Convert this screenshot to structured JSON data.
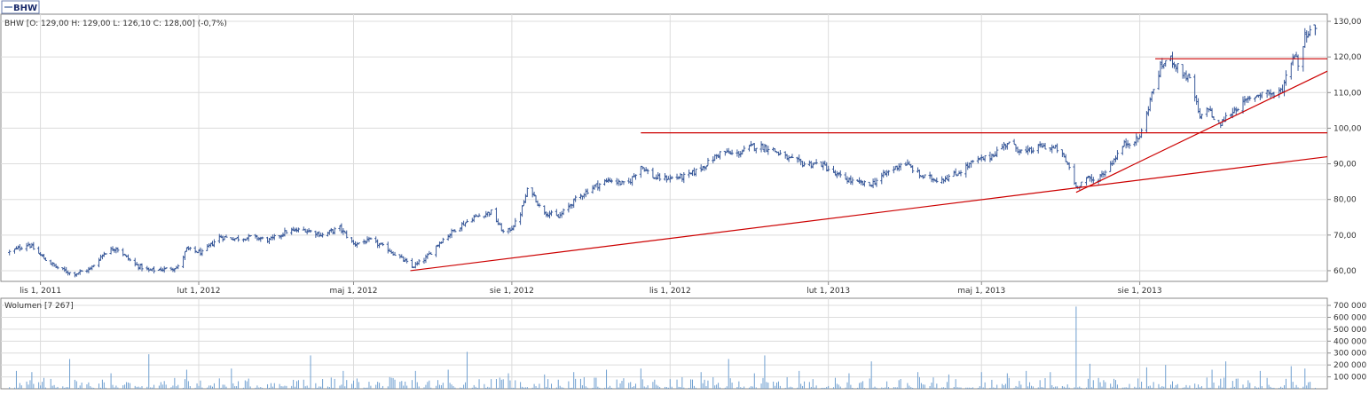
{
  "tab": {
    "label": "BHW"
  },
  "colors": {
    "price": "#3a5a9a",
    "trend": "#cc0000",
    "volume": "#6f9fd0",
    "grid": "#dcdcdc",
    "frame": "#8a8a8a",
    "text": "#333333"
  },
  "chart_data": [
    {
      "type": "line",
      "style": "ohlc",
      "legend": "BHW [O: 129,00  H: 129,00  L: 126,10  C: 128,00] (-0,7%)",
      "ohlc": {
        "open": 129.0,
        "high": 129.0,
        "low": 126.1,
        "close": 128.0,
        "change_pct": -0.7
      },
      "x_ticks": [
        "lis 1, 2011",
        "lut 1, 2012",
        "maj 1, 2012",
        "sie 1, 2012",
        "lis 1, 2012",
        "lut 1, 2013",
        "maj 1, 2013",
        "sie 1, 2013"
      ],
      "y_ticks": [
        "60,00",
        "70,00",
        "80,00",
        "90,00",
        "100,00",
        "110,00",
        "120,00",
        "130,00"
      ],
      "ylim": [
        57,
        132
      ],
      "xlim": [
        "2011-10-09",
        "2013-11-18"
      ],
      "grid": true,
      "series": [
        {
          "values": [
            [
              "2011-10-14",
              65.2
            ],
            [
              "2011-10-25",
              67.5
            ],
            [
              "2011-11-03",
              63.5
            ],
            [
              "2011-11-10",
              61.0
            ],
            [
              "2011-11-20",
              59.0
            ],
            [
              "2011-11-30",
              60.5
            ],
            [
              "2011-12-08",
              65.0
            ],
            [
              "2011-12-15",
              66.5
            ],
            [
              "2011-12-25",
              62.0
            ],
            [
              "2012-01-03",
              60.0
            ],
            [
              "2012-01-13",
              60.5
            ],
            [
              "2012-01-20",
              61.0
            ],
            [
              "2012-01-25",
              66.0
            ],
            [
              "2012-02-03",
              65.0
            ],
            [
              "2012-02-13",
              69.5
            ],
            [
              "2012-02-23",
              69.0
            ],
            [
              "2012-03-03",
              69.5
            ],
            [
              "2012-03-13",
              68.5
            ],
            [
              "2012-03-23",
              71.0
            ],
            [
              "2012-04-03",
              71.5
            ],
            [
              "2012-04-13",
              70.0
            ],
            [
              "2012-04-23",
              72.0
            ],
            [
              "2012-05-01",
              67.5
            ],
            [
              "2012-05-11",
              68.5
            ],
            [
              "2012-05-21",
              66.0
            ],
            [
              "2012-05-30",
              63.0
            ],
            [
              "2012-06-04",
              61.0
            ],
            [
              "2012-06-12",
              63.5
            ],
            [
              "2012-06-20",
              68.0
            ],
            [
              "2012-06-30",
              72.0
            ],
            [
              "2012-07-10",
              75.0
            ],
            [
              "2012-07-20",
              76.5
            ],
            [
              "2012-07-28",
              70.0
            ],
            [
              "2012-08-05",
              74.5
            ],
            [
              "2012-08-11",
              84.0
            ],
            [
              "2012-08-18",
              77.0
            ],
            [
              "2012-08-28",
              75.0
            ],
            [
              "2012-09-07",
              80.0
            ],
            [
              "2012-09-17",
              83.5
            ],
            [
              "2012-09-27",
              85.5
            ],
            [
              "2012-10-07",
              84.0
            ],
            [
              "2012-10-15",
              89.5
            ],
            [
              "2012-10-23",
              86.0
            ],
            [
              "2012-11-01",
              86.0
            ],
            [
              "2012-11-11",
              86.5
            ],
            [
              "2012-11-21",
              89.5
            ],
            [
              "2012-12-01",
              93.5
            ],
            [
              "2012-12-09",
              92.5
            ],
            [
              "2012-12-19",
              95.0
            ],
            [
              "2012-12-29",
              94.5
            ],
            [
              "2013-01-08",
              91.5
            ],
            [
              "2013-01-18",
              90.0
            ],
            [
              "2013-01-28",
              90.0
            ],
            [
              "2013-02-05",
              87.0
            ],
            [
              "2013-02-15",
              85.0
            ],
            [
              "2013-02-25",
              84.0
            ],
            [
              "2013-03-07",
              87.5
            ],
            [
              "2013-03-17",
              90.5
            ],
            [
              "2013-03-27",
              86.5
            ],
            [
              "2013-04-06",
              85.5
            ],
            [
              "2013-04-16",
              87.0
            ],
            [
              "2013-04-26",
              90.5
            ],
            [
              "2013-05-06",
              92.0
            ],
            [
              "2013-05-16",
              96.0
            ],
            [
              "2013-05-26",
              93.0
            ],
            [
              "2013-06-05",
              95.0
            ],
            [
              "2013-06-15",
              94.0
            ],
            [
              "2013-06-21",
              89.0
            ],
            [
              "2013-06-25",
              83.5
            ],
            [
              "2013-07-01",
              86.0
            ],
            [
              "2013-07-06",
              85.0
            ],
            [
              "2013-07-13",
              88.5
            ],
            [
              "2013-07-23",
              95.5
            ],
            [
              "2013-07-31",
              97.0
            ],
            [
              "2013-08-03",
              100.0
            ],
            [
              "2013-08-07",
              108.0
            ],
            [
              "2013-08-13",
              117.0
            ],
            [
              "2013-08-18",
              120.0
            ],
            [
              "2013-08-24",
              116.5
            ],
            [
              "2013-08-31",
              113.0
            ],
            [
              "2013-09-05",
              102.5
            ],
            [
              "2013-09-10",
              106.0
            ],
            [
              "2013-09-15",
              100.0
            ],
            [
              "2013-09-20",
              103.0
            ],
            [
              "2013-09-27",
              106.0
            ],
            [
              "2013-10-05",
              108.5
            ],
            [
              "2013-10-13",
              110.5
            ],
            [
              "2013-10-19",
              109.0
            ],
            [
              "2013-10-23",
              111.0
            ],
            [
              "2013-10-27",
              118.0
            ],
            [
              "2013-10-30",
              121.0
            ],
            [
              "2013-11-02",
              117.0
            ],
            [
              "2013-11-05",
              126.0
            ],
            [
              "2013-11-08",
              128.0
            ]
          ]
        }
      ],
      "trendlines": [
        {
          "from": [
            "2012-06-03",
            60.0
          ],
          "to": [
            "2013-11-20",
            92.0
          ]
        },
        {
          "from": [
            "2013-06-25",
            82.0
          ],
          "to": [
            "2013-11-25",
            116.0
          ]
        },
        {
          "from": [
            "2012-10-15",
            98.7
          ],
          "to": [
            "2013-11-20",
            98.7
          ]
        },
        {
          "from": [
            "2013-08-10",
            119.5
          ],
          "to": [
            "2013-11-20",
            119.5
          ]
        }
      ]
    },
    {
      "type": "bar",
      "legend": "Wolumen [7 267]",
      "y_ticks": [
        "100 000",
        "200 000",
        "300 000",
        "400 000",
        "500 000",
        "600 000",
        "700 000"
      ],
      "ylim": [
        0,
        760000
      ],
      "grid": true,
      "spikes": [
        [
          "2011-10-18",
          150000
        ],
        [
          "2011-10-27",
          140000
        ],
        [
          "2011-11-05",
          120000
        ],
        [
          "2011-11-18",
          250000
        ],
        [
          "2011-12-12",
          130000
        ],
        [
          "2011-12-25",
          110000
        ],
        [
          "2012-01-03",
          290000
        ],
        [
          "2012-01-25",
          160000
        ],
        [
          "2012-02-20",
          170000
        ],
        [
          "2012-03-17",
          130000
        ],
        [
          "2012-04-06",
          280000
        ],
        [
          "2012-04-25",
          150000
        ],
        [
          "2012-05-20",
          140000
        ],
        [
          "2012-06-06",
          150000
        ],
        [
          "2012-06-25",
          160000
        ],
        [
          "2012-07-06",
          310000
        ],
        [
          "2012-07-30",
          130000
        ],
        [
          "2012-08-11",
          210000
        ],
        [
          "2012-08-20",
          120000
        ],
        [
          "2012-09-06",
          140000
        ],
        [
          "2012-09-25",
          160000
        ],
        [
          "2012-10-15",
          170000
        ],
        [
          "2012-11-03",
          120000
        ],
        [
          "2012-11-19",
          140000
        ],
        [
          "2012-12-05",
          250000
        ],
        [
          "2012-12-20",
          130000
        ],
        [
          "2012-12-26",
          280000
        ],
        [
          "2013-01-15",
          150000
        ],
        [
          "2013-02-13",
          130000
        ],
        [
          "2013-02-26",
          230000
        ],
        [
          "2013-03-25",
          140000
        ],
        [
          "2013-04-12",
          120000
        ],
        [
          "2013-05-01",
          140000
        ],
        [
          "2013-05-16",
          130000
        ],
        [
          "2013-05-27",
          150000
        ],
        [
          "2013-06-10",
          140000
        ],
        [
          "2013-06-23",
          170000
        ],
        [
          "2013-06-25",
          690000
        ],
        [
          "2013-07-03",
          210000
        ],
        [
          "2013-07-20",
          140000
        ],
        [
          "2013-08-05",
          180000
        ],
        [
          "2013-08-16",
          200000
        ],
        [
          "2013-08-31",
          170000
        ],
        [
          "2013-09-12",
          160000
        ],
        [
          "2013-09-20",
          230000
        ],
        [
          "2013-10-10",
          150000
        ],
        [
          "2013-10-28",
          190000
        ],
        [
          "2013-11-05",
          170000
        ]
      ]
    }
  ]
}
